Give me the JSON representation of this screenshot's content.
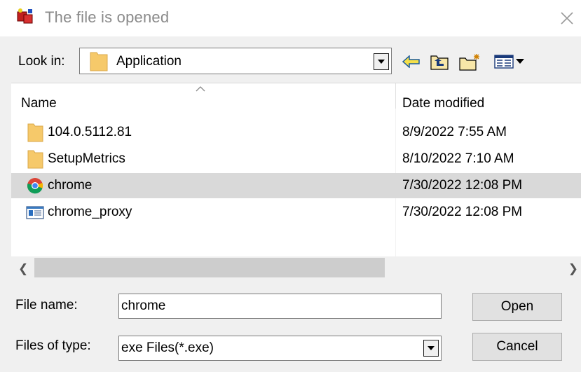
{
  "window": {
    "title": "The file is opened",
    "icon": "app-icon",
    "close": "close-icon"
  },
  "lookin": {
    "label": "Look in:",
    "value": "Application",
    "toolbar": [
      "back-arrow-icon",
      "up-folder-icon",
      "new-folder-icon",
      "view-menu-icon"
    ]
  },
  "list": {
    "columns": [
      "Name",
      "Date modified"
    ],
    "rows": [
      {
        "name": "104.0.5112.81",
        "date": "8/9/2022 7:55 AM",
        "icon": "folder-icon"
      },
      {
        "name": "SetupMetrics",
        "date": "8/10/2022 7:10 AM",
        "icon": "folder-icon"
      },
      {
        "name": "chrome",
        "date": "7/30/2022 12:08 PM",
        "icon": "chrome-icon",
        "selected": true
      },
      {
        "name": "chrome_proxy",
        "date": "7/30/2022 12:08 PM",
        "icon": "application-icon"
      }
    ]
  },
  "bottom": {
    "filename_label": "File name:",
    "filename_value": "chrome",
    "filetype_label": "Files of type:",
    "filetype_value": "exe Files(*.exe)",
    "open_label": "Open",
    "cancel_label": "Cancel"
  },
  "colors": {
    "selection": "#d9d9d9",
    "folder": "#f6c96a",
    "accent_blue": "#2a6ebf"
  }
}
